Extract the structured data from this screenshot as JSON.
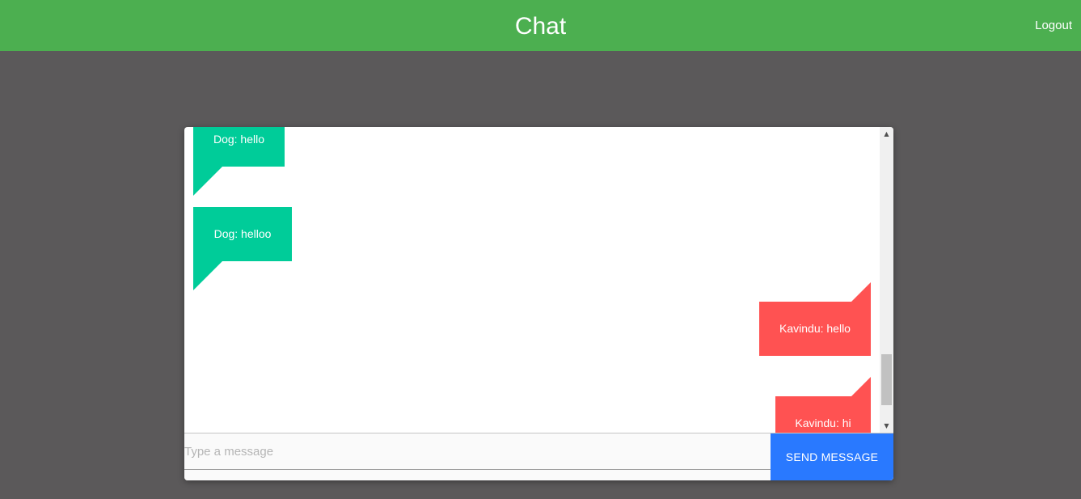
{
  "header": {
    "title": "Chat",
    "logout_label": "Logout",
    "color": "#4caf50"
  },
  "messages": [
    {
      "sender": "Dog",
      "text": "Dog: hello",
      "direction": "incoming",
      "color": "#00cc99"
    },
    {
      "sender": "Dog",
      "text": "Dog: helloo",
      "direction": "incoming",
      "color": "#00cc99"
    },
    {
      "sender": "Kavindu",
      "text": "Kavindu: hello",
      "direction": "outgoing",
      "color": "#ff5252"
    },
    {
      "sender": "Kavindu",
      "text": "Kavindu: hi",
      "direction": "outgoing",
      "color": "#ff5252"
    }
  ],
  "composer": {
    "placeholder": "Type a message",
    "value": "",
    "send_label": "SEND MESSAGE",
    "send_color": "#2979ff"
  }
}
